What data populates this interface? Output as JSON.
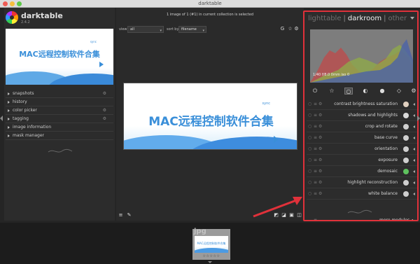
{
  "window": {
    "title": "darktable"
  },
  "brand": {
    "name": "darktable",
    "version": "2.4.2"
  },
  "thumbnail": {
    "title": "MAC远程控制软件合集",
    "brand_text": "sync"
  },
  "left_modules": [
    {
      "label": "snapshots"
    },
    {
      "label": "history"
    },
    {
      "label": "color picker"
    },
    {
      "label": "tagging"
    },
    {
      "label": "image information"
    },
    {
      "label": "mask manager"
    }
  ],
  "center": {
    "message": "1 image of 1 (#1) in current collection is selected",
    "view_label": "view",
    "view_value": "all",
    "sort_label": "sort by",
    "sort_value": "filename",
    "image_title": "MAC远程控制软件合集",
    "image_brand": "sync"
  },
  "right": {
    "tabs": {
      "lighttable": "lighttable",
      "sep": "|",
      "darkroom": "darkroom",
      "other": "other"
    },
    "histogram_info": "1/40 f/8.0 0mm iso 0",
    "modules": [
      {
        "label": "contrast brightness saturation",
        "icon_color": "#e0d0c0"
      },
      {
        "label": "shadows and highlights",
        "icon_color": "#d8d8d8"
      },
      {
        "label": "crop and rotate",
        "icon_color": "#cfcfcf"
      },
      {
        "label": "base curve",
        "icon_color": "#cfcfcf"
      },
      {
        "label": "orientation",
        "icon_color": "#cfcfcf"
      },
      {
        "label": "exposure",
        "icon_color": "#cfcfcf"
      },
      {
        "label": "demosaic",
        "icon_color": "#5ec25e"
      },
      {
        "label": "highlight reconstruction",
        "icon_color": "#cfcfcf"
      },
      {
        "label": "white balance",
        "icon_color": "#cfcfcf"
      }
    ],
    "more_modules": "more modules"
  },
  "filmstrip": {
    "extension": "jpg",
    "thumb_title": "MAC远程控制软件合集",
    "stars": "☆☆☆☆☆"
  },
  "colors": {
    "annotation": "#e0313a",
    "accent": "#3a8fd9"
  }
}
